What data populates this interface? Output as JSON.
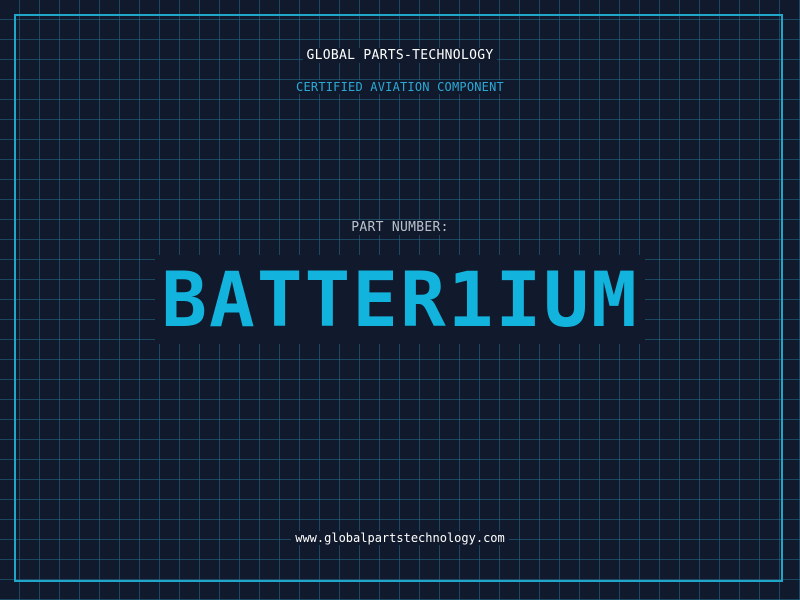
{
  "company_name": "GLOBAL PARTS-TECHNOLOGY",
  "subtitle": "CERTIFIED AVIATION COMPONENT",
  "part_label": "PART NUMBER:",
  "part_number": "BATTER1IUM",
  "website": "www.globalpartstechnology.com",
  "colors": {
    "background": "#111a2c",
    "grid": "#266e8c",
    "frame": "#1fa6c9",
    "accent": "#12b3dc"
  }
}
